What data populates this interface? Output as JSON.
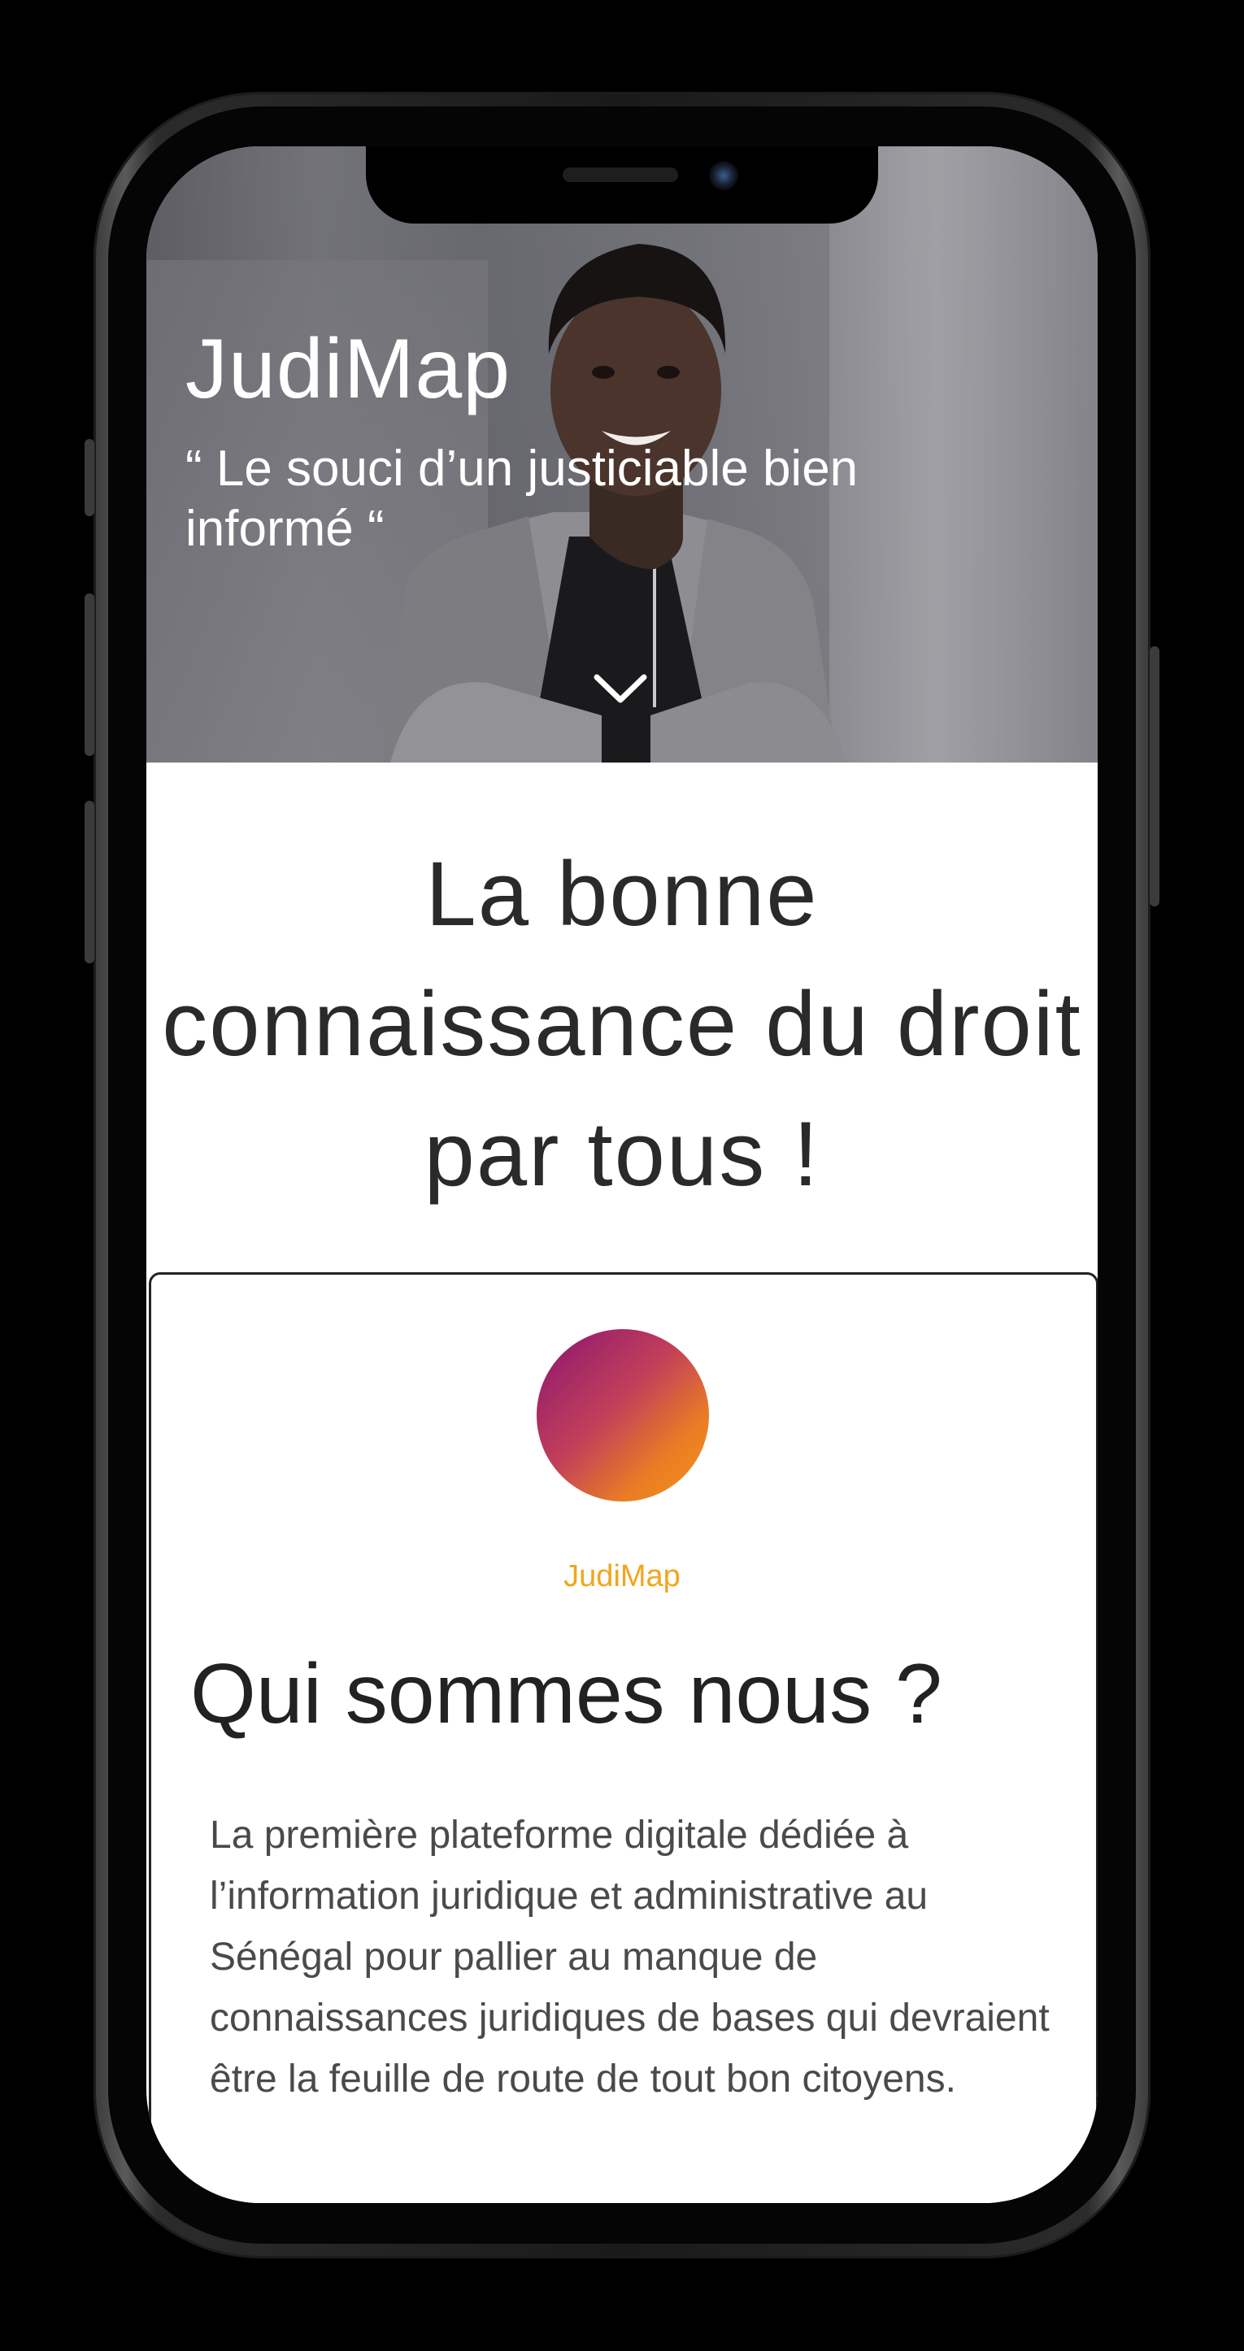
{
  "hero": {
    "title": "JudiMap",
    "quote": "“ Le souci d’un justiciable bien informé “",
    "scroll_icon": "chevron-down-icon"
  },
  "tagline": {
    "line1": "La bonne",
    "line2": "connaissance du droit",
    "line3": "par tous !"
  },
  "about": {
    "brand_label": "JudiMap",
    "title": "Qui sommes nous ?",
    "body": "La première plateforme digitale dédiée à l’information juridique et administrative au Sénégal pour pallier au manque de connaissances juridiques de bases qui devraient être la feuille de route de tout bon citoyens."
  },
  "colors": {
    "brand_orange": "#f0a61c",
    "gradient_start": "#8a1470",
    "gradient_end": "#f5951a",
    "text_dark": "#222222"
  }
}
